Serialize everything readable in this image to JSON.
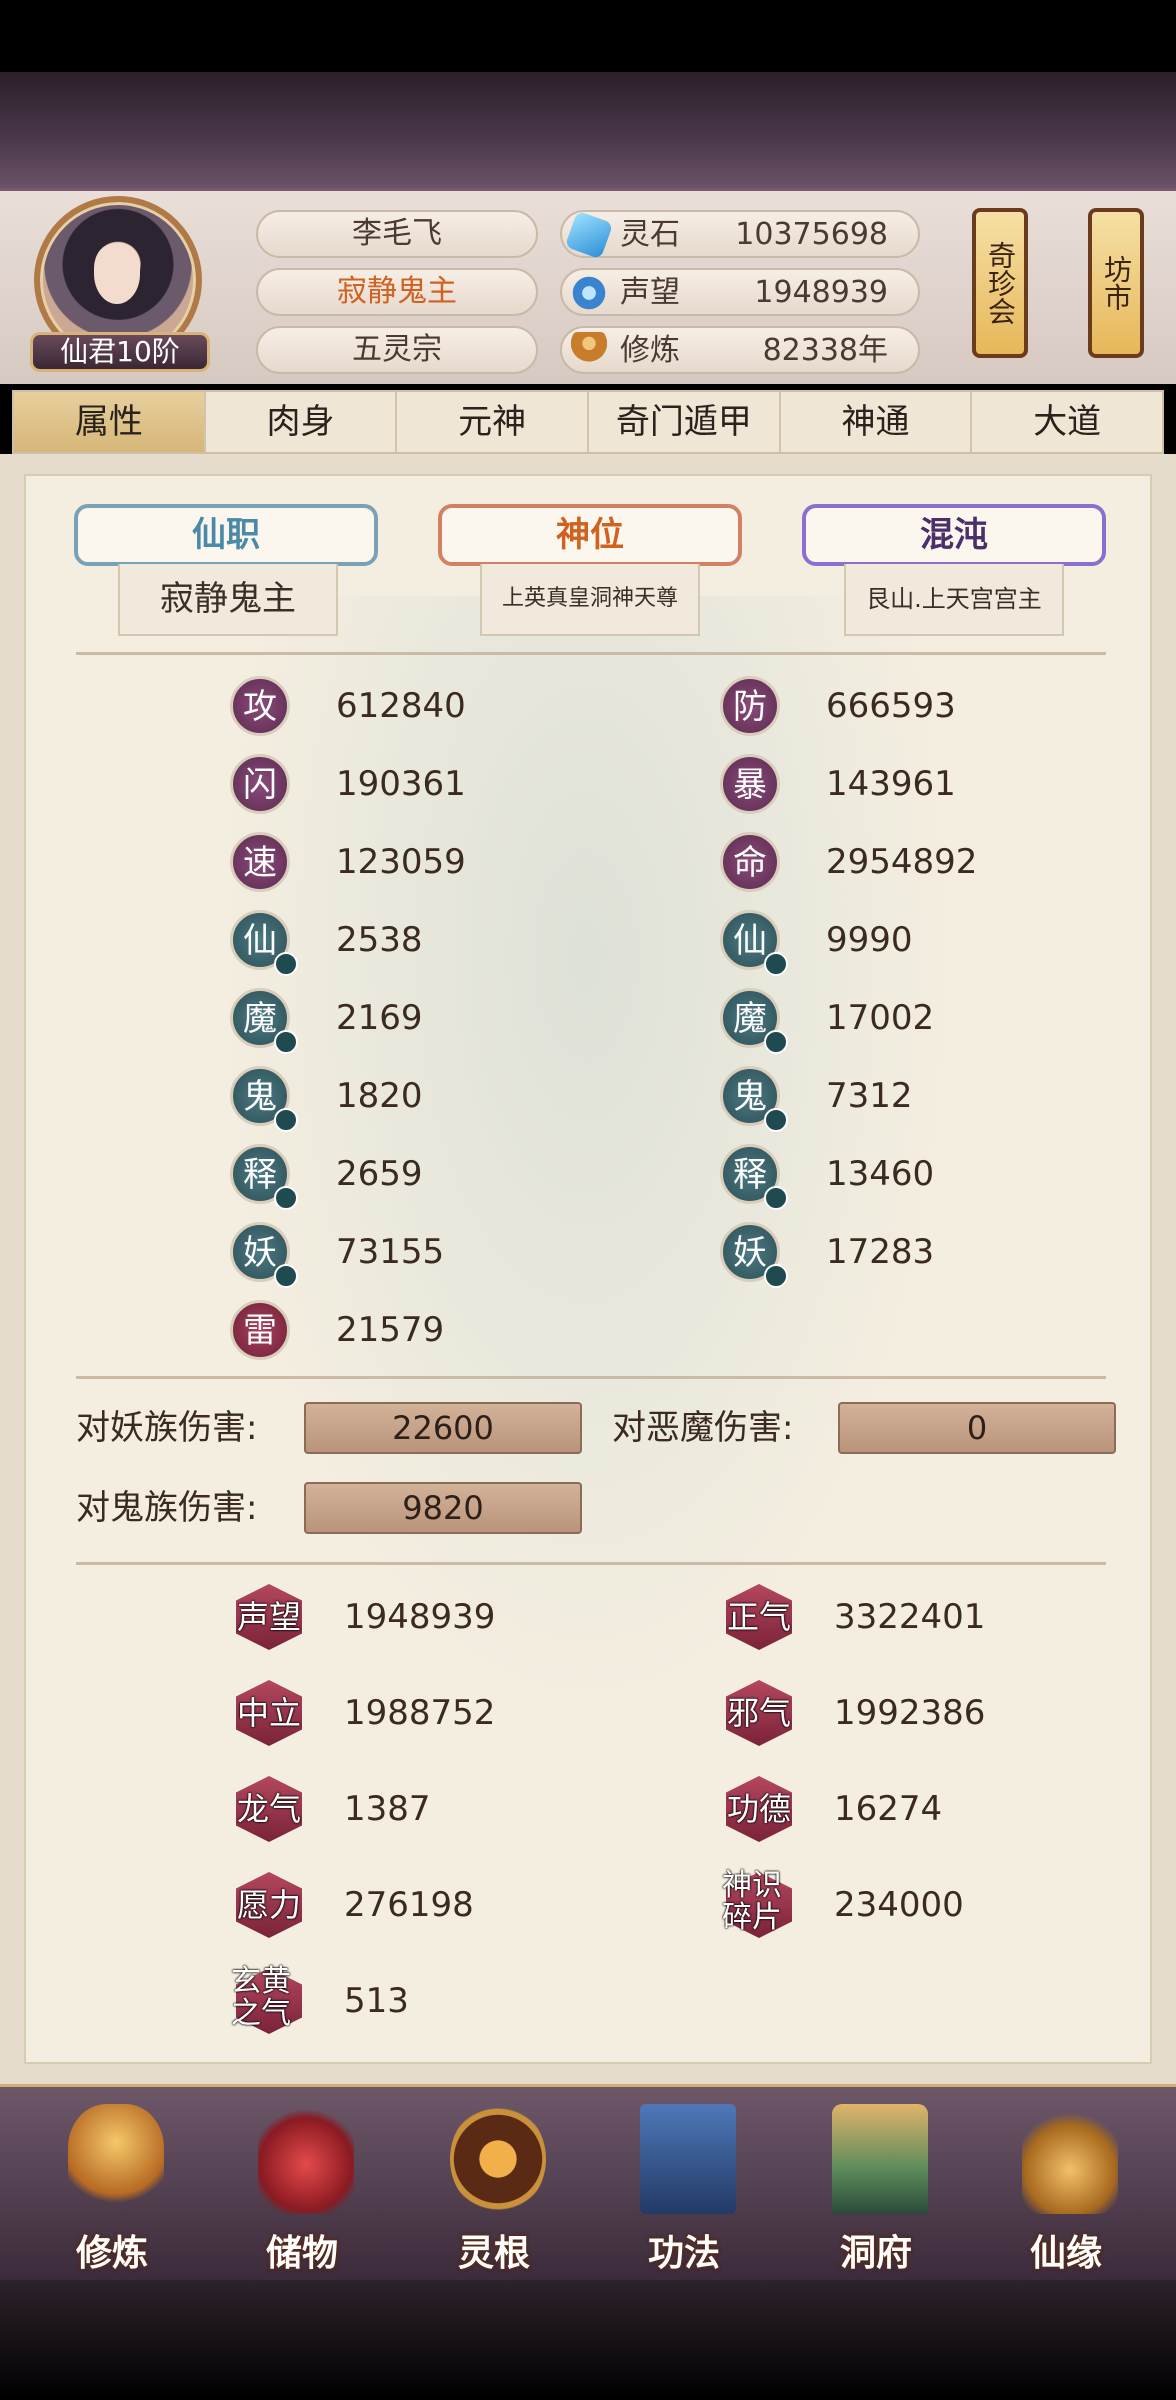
{
  "header": {
    "rank": "仙君10阶",
    "name": "李毛飞",
    "title": "寂静鬼主",
    "sect": "五灵宗",
    "resources": [
      {
        "icon": "spirit-stone-icon",
        "label": "灵石",
        "value": "10375698"
      },
      {
        "icon": "fame-icon",
        "label": "声望",
        "value": "1948939"
      },
      {
        "icon": "meditation-icon",
        "label": "修炼",
        "value": "82338年"
      }
    ],
    "side_buttons": [
      {
        "label": "奇珍会"
      },
      {
        "label": "坊市"
      }
    ]
  },
  "tabs": [
    "属性",
    "肉身",
    "元神",
    "奇门遁甲",
    "神通",
    "大道"
  ],
  "active_tab": "属性",
  "ranks": {
    "xianzhi": {
      "label": "仙职",
      "value": "寂静鬼主"
    },
    "shenwei": {
      "label": "神位",
      "value": "上英真皇洞神天尊"
    },
    "hundun": {
      "label": "混沌",
      "value": "艮山.上天宫宫主"
    }
  },
  "stats_left": [
    {
      "glyph": "攻",
      "value": "612840"
    },
    {
      "glyph": "闪",
      "value": "190361"
    },
    {
      "glyph": "速",
      "value": "123059"
    },
    {
      "glyph": "仙",
      "value": "2538"
    },
    {
      "glyph": "魔",
      "value": "2169"
    },
    {
      "glyph": "鬼",
      "value": "1820"
    },
    {
      "glyph": "释",
      "value": "2659"
    },
    {
      "glyph": "妖",
      "value": "73155"
    },
    {
      "glyph": "雷",
      "value": "21579"
    }
  ],
  "stats_right": [
    {
      "glyph": "防",
      "value": "666593"
    },
    {
      "glyph": "暴",
      "value": "143961"
    },
    {
      "glyph": "命",
      "value": "2954892"
    },
    {
      "glyph": "仙",
      "value": "9990"
    },
    {
      "glyph": "魔",
      "value": "17002"
    },
    {
      "glyph": "鬼",
      "value": "7312"
    },
    {
      "glyph": "释",
      "value": "13460"
    },
    {
      "glyph": "妖",
      "value": "17283"
    }
  ],
  "damage": {
    "yao_label": "对妖族伤害:",
    "yao_value": "22600",
    "emo_label": "对恶魔伤害:",
    "emo_value": "0",
    "gui_label": "对鬼族伤害:",
    "gui_value": "9820"
  },
  "reputation_left": [
    {
      "label": "声望",
      "value": "1948939"
    },
    {
      "label": "中立",
      "value": "1988752"
    },
    {
      "label": "龙气",
      "value": "1387"
    },
    {
      "label": "愿力",
      "value": "276198"
    },
    {
      "label": "玄黄之气",
      "value": "513"
    }
  ],
  "reputation_right": [
    {
      "label": "正气",
      "value": "3322401"
    },
    {
      "label": "邪气",
      "value": "1992386"
    },
    {
      "label": "功德",
      "value": "16274"
    },
    {
      "label": "神识碎片",
      "value": "234000"
    }
  ],
  "bottom_nav": [
    {
      "label": "修炼",
      "icon": "cultivate-icon"
    },
    {
      "label": "储物",
      "icon": "storage-bag-icon"
    },
    {
      "label": "灵根",
      "icon": "spirit-root-icon"
    },
    {
      "label": "功法",
      "icon": "technique-book-icon"
    },
    {
      "label": "洞府",
      "icon": "cave-mansion-icon"
    },
    {
      "label": "仙缘",
      "icon": "gourd-icon"
    }
  ]
}
